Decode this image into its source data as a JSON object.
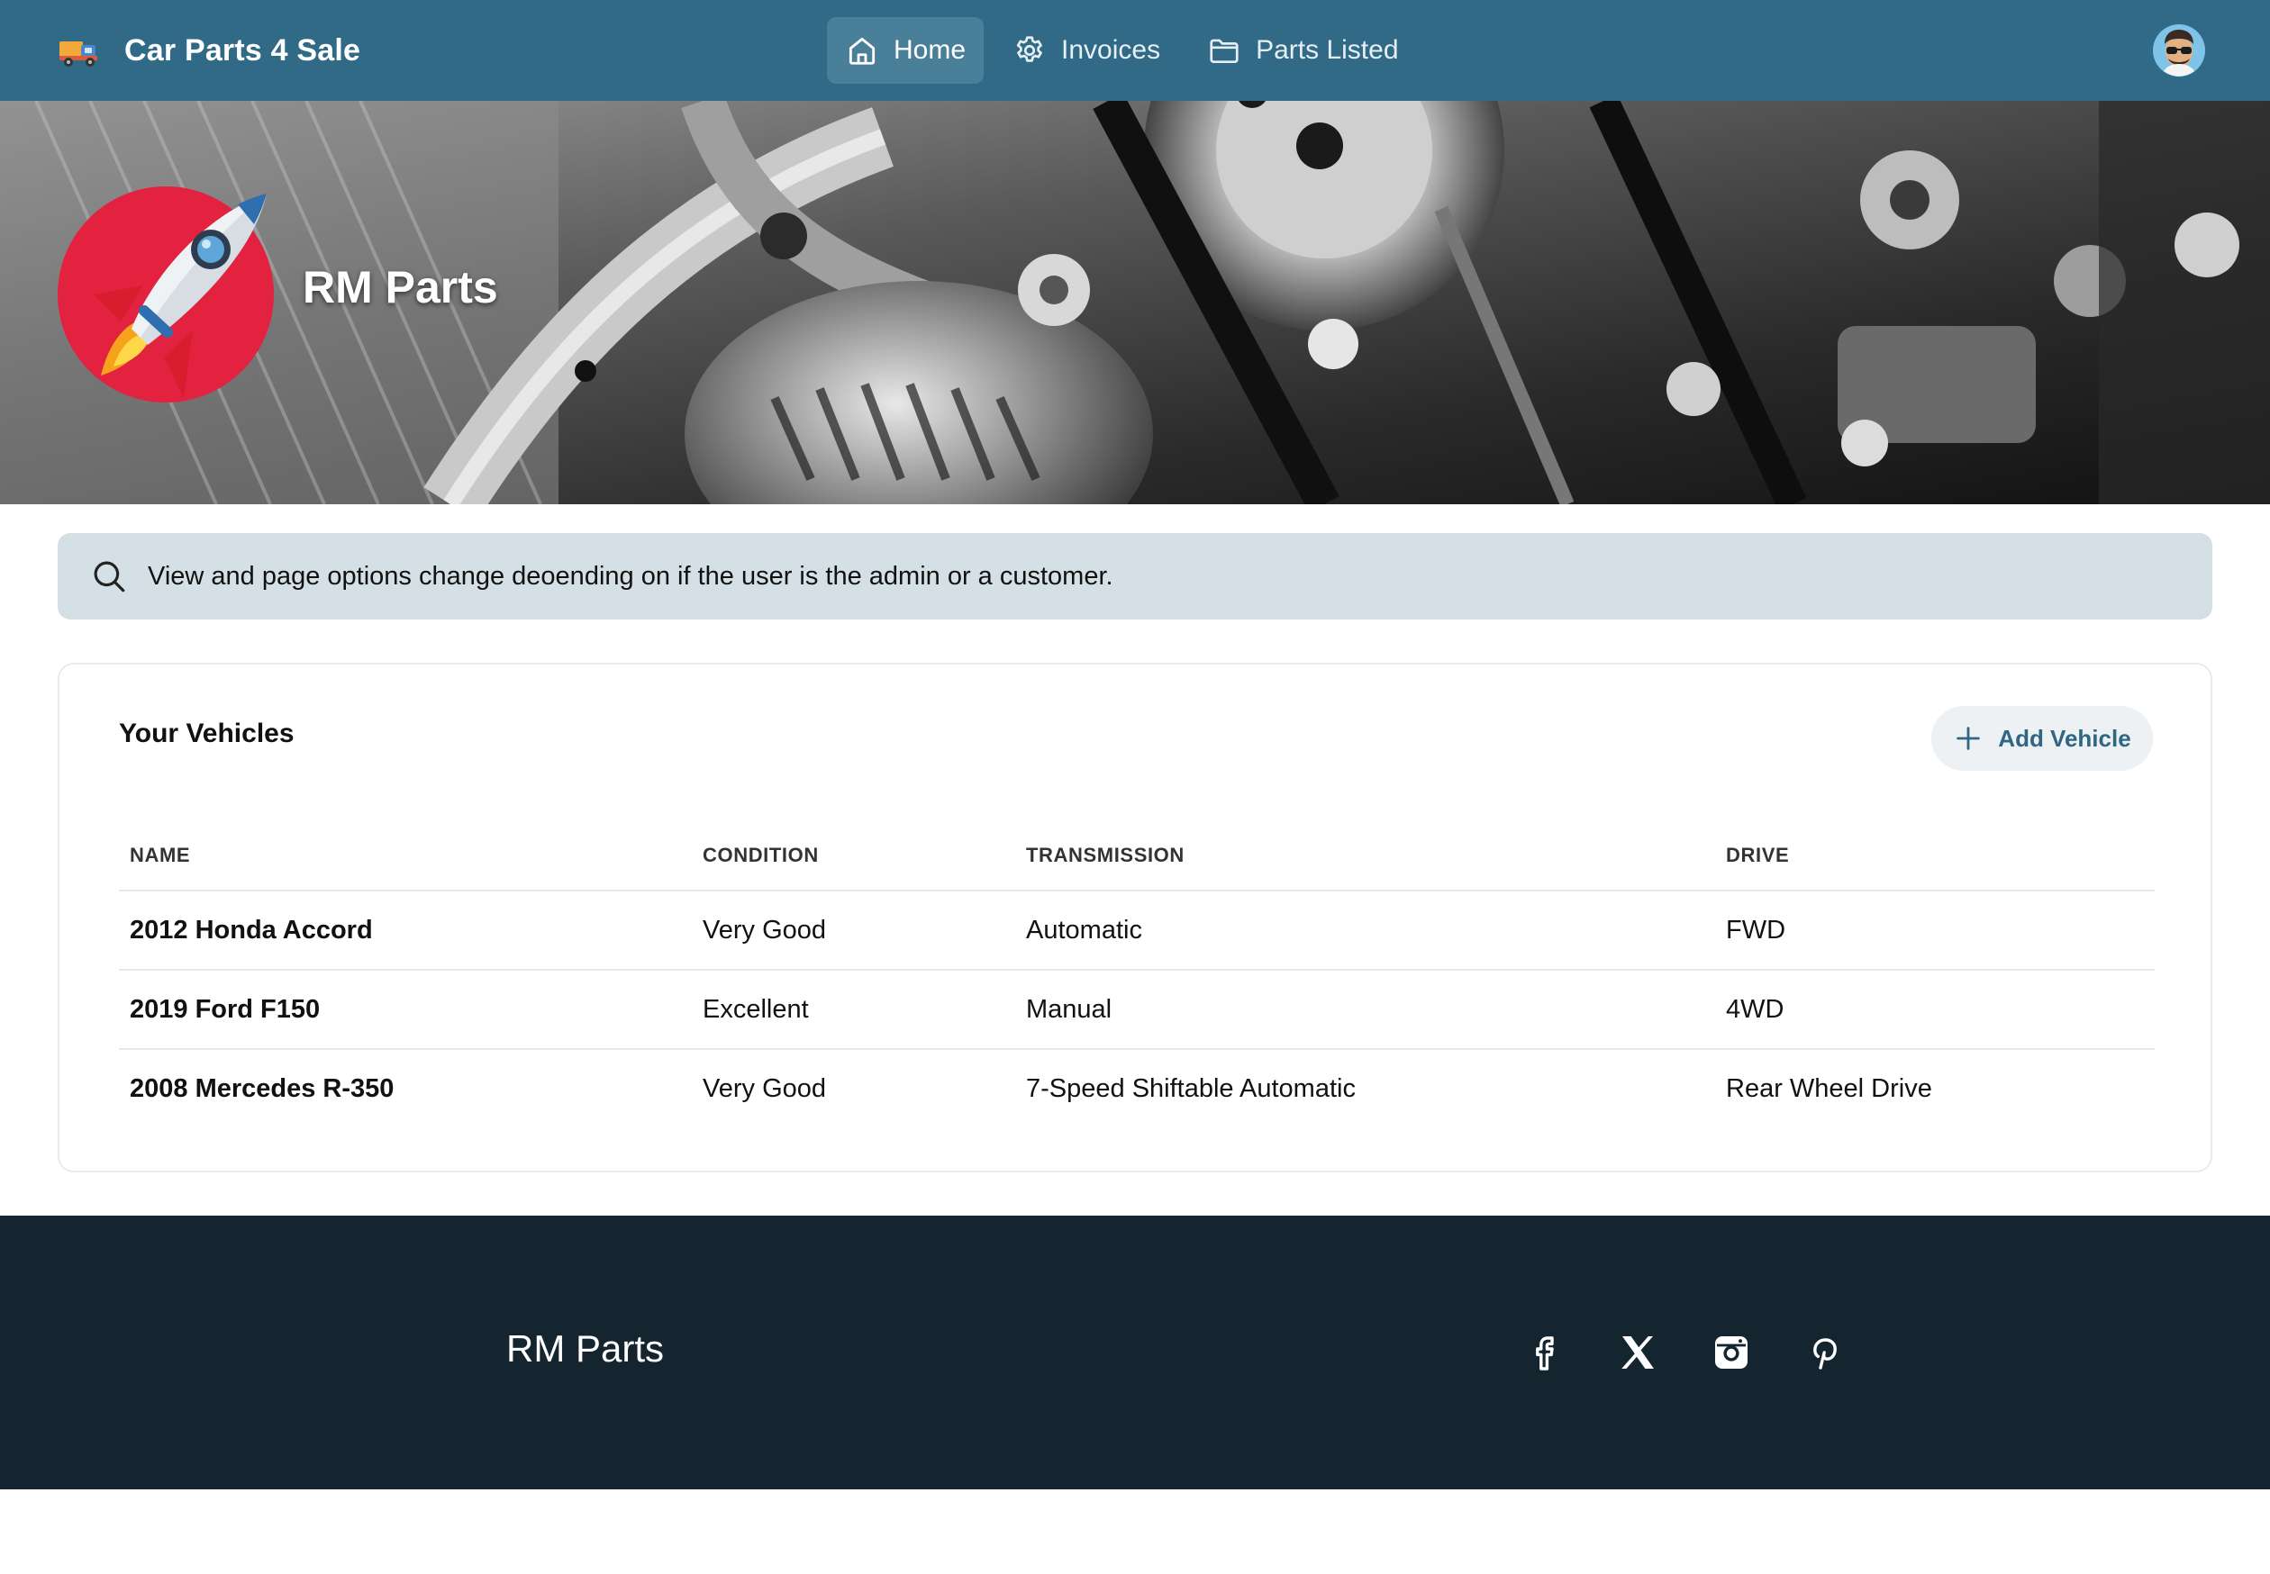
{
  "topbar": {
    "brand_name": "Car Parts 4 Sale",
    "nav": [
      {
        "label": "Home",
        "icon": "home-icon",
        "active": true
      },
      {
        "label": "Invoices",
        "icon": "gear-icon",
        "active": false
      },
      {
        "label": "Parts Listed",
        "icon": "folder-icon",
        "active": false
      }
    ]
  },
  "hero": {
    "shop_name": "RM Parts",
    "logo_icon": "rocket-icon"
  },
  "info": {
    "text": "View and page options change deoending on if the user is the admin or a customer."
  },
  "vehicles": {
    "title": "Your Vehicles",
    "add_label": "Add Vehicle",
    "columns": [
      "NAME",
      "CONDITION",
      "TRANSMISSION",
      "DRIVE"
    ],
    "rows": [
      [
        "2012 Honda Accord",
        "Very Good",
        "Automatic",
        "FWD"
      ],
      [
        "2019 Ford F150",
        "Excellent",
        "Manual",
        "4WD"
      ],
      [
        "2008 Mercedes R-350",
        "Very Good",
        "7-Speed Shiftable Automatic",
        "Rear Wheel Drive"
      ]
    ]
  },
  "footer": {
    "brand": "RM Parts",
    "socials": [
      "facebook-icon",
      "x-icon",
      "instagram-icon",
      "pinterest-icon"
    ]
  },
  "colors": {
    "topbar": "#306a87",
    "nav_active": "#4a7f9a",
    "info_bg": "#d4e0e6",
    "accent": "#2f6684",
    "footer": "#142530",
    "logo_red": "#e3223f"
  }
}
